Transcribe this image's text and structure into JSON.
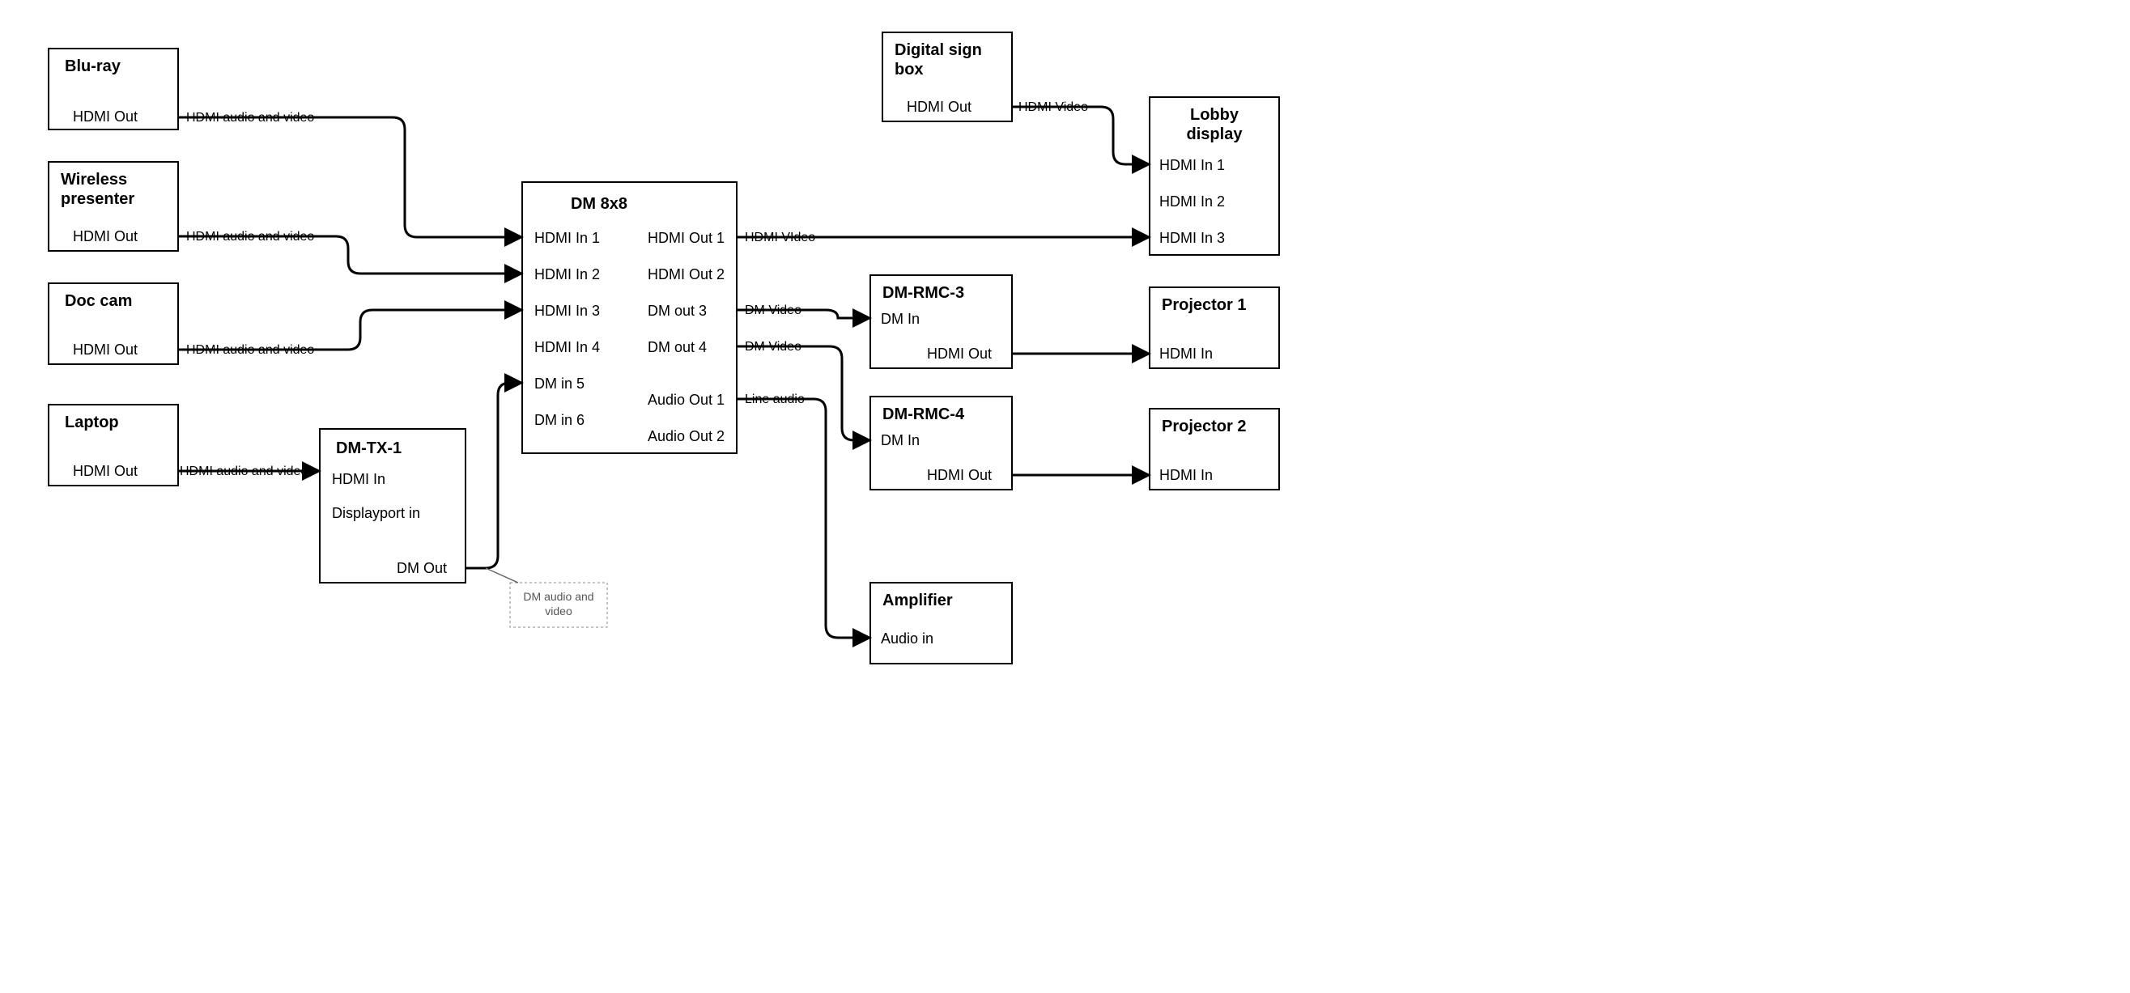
{
  "nodes": {
    "bluray": {
      "title": "Blu-ray",
      "ports": {
        "out": "HDMI Out"
      }
    },
    "wireless": {
      "title": "Wireless presenter",
      "ports": {
        "out": "HDMI Out"
      }
    },
    "doccam": {
      "title": "Doc cam",
      "ports": {
        "out": "HDMI Out"
      }
    },
    "laptop": {
      "title": "Laptop",
      "ports": {
        "out": "HDMI Out"
      }
    },
    "dmtx1": {
      "title": "DM-TX-1",
      "ports": {
        "in1": "HDMI In",
        "in2": "Displayport in",
        "out": "DM Out"
      }
    },
    "dm8x8": {
      "title": "DM 8x8",
      "ports": {
        "in1": "HDMI In 1",
        "in2": "HDMI In 2",
        "in3": "HDMI In 3",
        "in4": "HDMI In 4",
        "in5": "DM in 5",
        "in6": "DM in 6",
        "out1": "HDMI Out 1",
        "out2": "HDMI Out 2",
        "out3": "DM out 3",
        "out4": "DM out 4",
        "aout1": "Audio Out 1",
        "aout2": "Audio Out 2"
      }
    },
    "sign": {
      "title": "Digital sign box",
      "ports": {
        "out": "HDMI Out"
      }
    },
    "lobby": {
      "title": "Lobby display",
      "ports": {
        "in1": "HDMI In 1",
        "in2": "HDMI In 2",
        "in3": "HDMI In 3"
      }
    },
    "rmc3": {
      "title": "DM-RMC-3",
      "ports": {
        "in": "DM In",
        "out": "HDMI Out"
      }
    },
    "rmc4": {
      "title": "DM-RMC-4",
      "ports": {
        "in": "DM In",
        "out": "HDMI Out"
      }
    },
    "proj1": {
      "title": "Projector 1",
      "ports": {
        "in": "HDMI In"
      }
    },
    "proj2": {
      "title": "Projector 2",
      "ports": {
        "in": "HDMI In"
      }
    },
    "amp": {
      "title": "Amplifier",
      "ports": {
        "in": "Audio in"
      }
    }
  },
  "edges": {
    "e_bluray": "HDMI audio and video",
    "e_wireless": "HDMI audio and video",
    "e_doccam": "HDMI audio and video",
    "e_laptop": "HDMI audio and video",
    "e_sign": "HDMI Video",
    "e_out1": "HDMI VIdeo",
    "e_out3": "DM Video",
    "e_out4": "DM Video",
    "e_aout1": "Line audio"
  },
  "notes": {
    "dm_av": "DM audio and video"
  }
}
